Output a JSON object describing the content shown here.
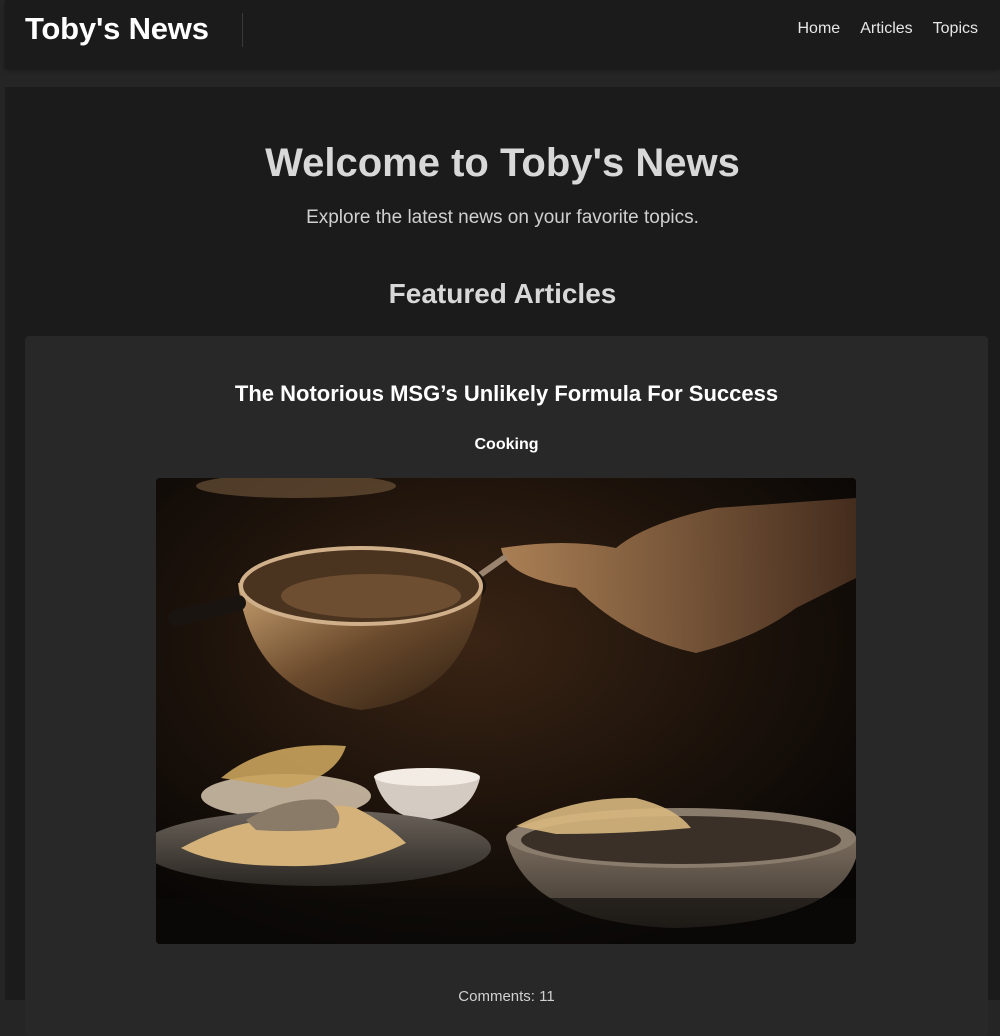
{
  "header": {
    "brand": "Toby's News",
    "nav": [
      {
        "label": "Home"
      },
      {
        "label": "Articles"
      },
      {
        "label": "Topics"
      }
    ]
  },
  "hero": {
    "title": "Welcome to Toby's News",
    "subtitle": "Explore the latest news on your favorite topics."
  },
  "featured": {
    "heading": "Featured Articles",
    "articles": [
      {
        "title": "The Notorious MSG’s Unlikely Formula For Success",
        "topic": "Cooking",
        "comments": "Comments: 11"
      }
    ]
  },
  "colors": {
    "page_background": "#252525",
    "panel_background": "#1b1b1b",
    "card_background": "#282828",
    "heading_text": "#d8d8d8",
    "nav_text": "#e6e6e6"
  }
}
